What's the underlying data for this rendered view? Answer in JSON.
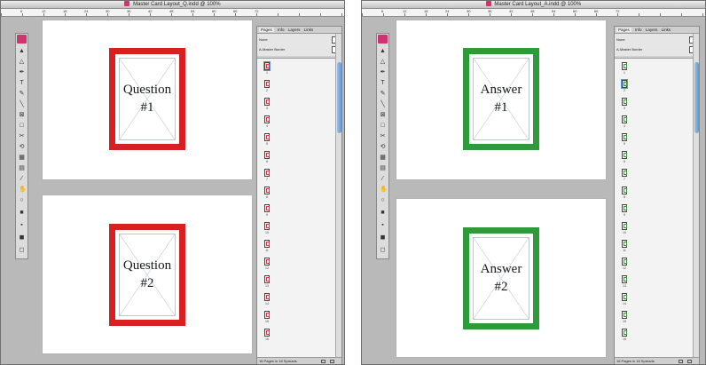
{
  "windows": [
    {
      "id": "question",
      "title": "Master Card Layout_Q.indd @ 100%",
      "cards": [
        {
          "line1": "Question",
          "line2": "#1"
        },
        {
          "line1": "Question",
          "line2": "#2"
        }
      ],
      "panel": {
        "tabs": [
          "Pages",
          "Info",
          "Layers",
          "Links"
        ],
        "masters": [
          "None",
          "A-Master Border"
        ],
        "page_numbers": [
          "1",
          "2",
          "3",
          "4",
          "5",
          "6",
          "7",
          "8",
          "9",
          "10",
          "11",
          "12",
          "13",
          "14",
          "15",
          "16"
        ],
        "footer": "16 Pages in 16 Spreads"
      },
      "accent_color": "#d82020"
    },
    {
      "id": "answer",
      "title": "Master Card Layout_A.indd @ 100%",
      "cards": [
        {
          "line1": "Answer",
          "line2": "#1"
        },
        {
          "line1": "Answer",
          "line2": "#2"
        }
      ],
      "panel": {
        "tabs": [
          "Pages",
          "Info",
          "Layers",
          "Links"
        ],
        "masters": [
          "None",
          "A-Master Border"
        ],
        "page_numbers": [
          "1",
          "2",
          "3",
          "4",
          "5",
          "6",
          "7",
          "8",
          "9",
          "10",
          "11",
          "12",
          "13",
          "14",
          "15",
          "16"
        ],
        "footer": "16 Pages in 16 Spreads"
      },
      "accent_color": "#2e9a3a"
    }
  ],
  "ruler_labels": [
    "6",
    "12",
    "18",
    "24",
    "30",
    "36",
    "42",
    "48",
    "54",
    "60",
    "66",
    "72"
  ],
  "tools": [
    "selection-tool",
    "direct-selection-tool",
    "pen-tool",
    "type-tool",
    "pencil-tool",
    "line-tool",
    "rectangle-frame-tool",
    "rectangle-tool",
    "scissors-tool",
    "free-transform-tool",
    "gradient-tool",
    "note-tool",
    "eyedropper-tool",
    "hand-tool",
    "zoom-tool",
    "fill-stroke-swatch",
    "apply-color-button",
    "normal-view-mode",
    "preview-mode"
  ]
}
